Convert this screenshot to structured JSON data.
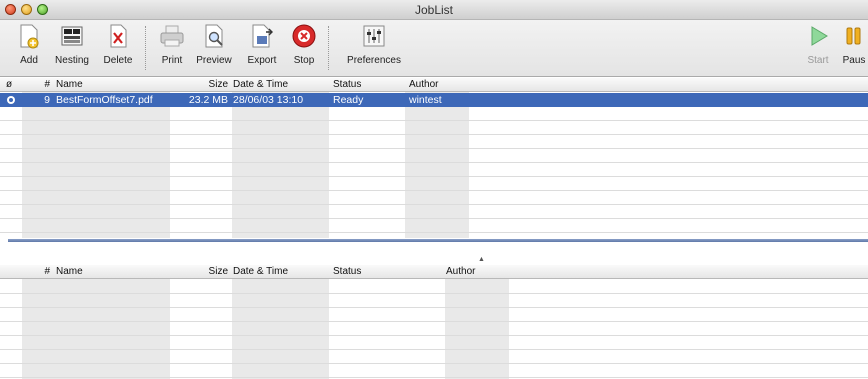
{
  "window": {
    "title": "JobList"
  },
  "toolbar": {
    "buttons": [
      {
        "label": "Add",
        "icon": "add-doc-icon"
      },
      {
        "label": "Nesting",
        "icon": "nesting-icon"
      },
      {
        "label": "Delete",
        "icon": "delete-doc-icon"
      },
      {
        "label": "Print",
        "icon": "printer-icon"
      },
      {
        "label": "Preview",
        "icon": "preview-icon"
      },
      {
        "label": "Export",
        "icon": "export-icon"
      },
      {
        "label": "Stop",
        "icon": "stop-icon"
      },
      {
        "label": "Preferences",
        "icon": "preferences-icon"
      },
      {
        "label": "Start",
        "icon": "play-icon"
      },
      {
        "label": "Paus",
        "icon": "pause-icon"
      }
    ]
  },
  "top_table": {
    "columns": {
      "status_icon": "ø",
      "num": "#",
      "name": "Name",
      "size": "Size",
      "datetime": "Date & Time",
      "status": "Status",
      "author": "Author"
    },
    "rows": [
      {
        "num": "9",
        "name": "BestFormOffset7.pdf",
        "size": "23.2 MB",
        "datetime": "28/06/03 13:10",
        "status": "Ready",
        "author": "wintest"
      }
    ]
  },
  "bottom_table": {
    "columns": {
      "num": "#",
      "name": "Name",
      "size": "Size",
      "datetime": "Date & Time",
      "status": "Status",
      "author": "Author"
    },
    "rows": []
  },
  "colors": {
    "selection": "#3d68b8",
    "splitter": "#6b84b4",
    "column_shade": "#e9e9e9"
  }
}
